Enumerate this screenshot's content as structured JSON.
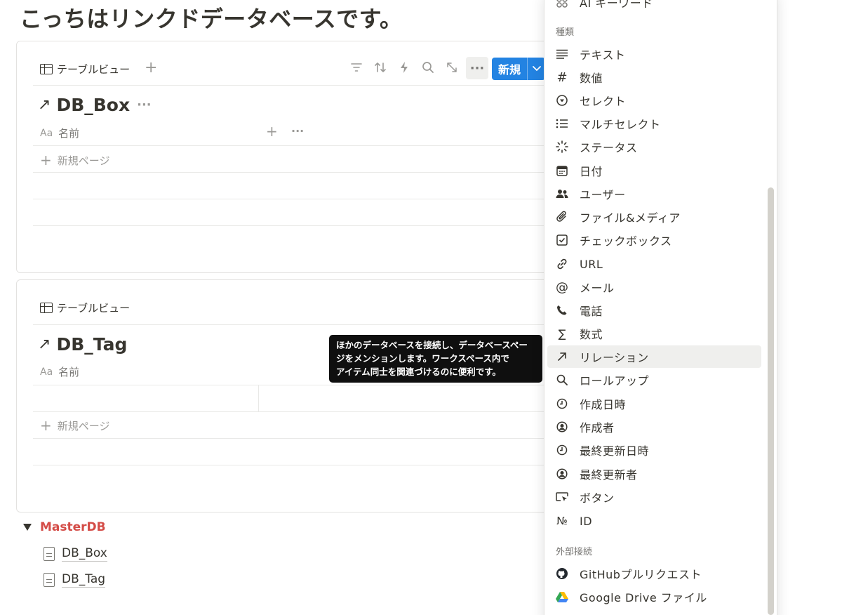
{
  "page": {
    "title": "こっちはリンクドデータベースです。"
  },
  "db1": {
    "view_label": "テーブルビュー",
    "add_view": "+",
    "db_title": "DB_Box",
    "column_icon": "Aa",
    "column_name": "名前",
    "add_column": "+",
    "more": "···",
    "new_page": "新規ページ",
    "new_button": "新規"
  },
  "db2": {
    "view_label": "テーブルビュー",
    "db_title": "DB_Tag",
    "column_icon": "Aa",
    "column_name": "名前",
    "new_page": "新規ページ"
  },
  "tooltip": {
    "lines": [
      "ほかのデータベースを接続し、データベースペー",
      "ジをメンションします。ワークスペース内で",
      "アイテム同士を関連づけるのに便利です。"
    ]
  },
  "menu": {
    "top_item": "AI キーワード",
    "section_types": "種類",
    "types": [
      {
        "label": "テキスト",
        "icon": "text-lines-icon"
      },
      {
        "label": "数値",
        "icon": "hash-icon"
      },
      {
        "label": "セレクト",
        "icon": "select-circle-icon"
      },
      {
        "label": "マルチセレクト",
        "icon": "list-icon"
      },
      {
        "label": "ステータス",
        "icon": "status-spinner-icon"
      },
      {
        "label": "日付",
        "icon": "calendar-icon"
      },
      {
        "label": "ユーザー",
        "icon": "people-icon"
      },
      {
        "label": "ファイル&メディア",
        "icon": "paperclip-icon"
      },
      {
        "label": "チェックボックス",
        "icon": "checkbox-icon"
      },
      {
        "label": "URL",
        "icon": "link-icon"
      },
      {
        "label": "メール",
        "icon": "at-icon"
      },
      {
        "label": "電話",
        "icon": "phone-icon"
      },
      {
        "label": "数式",
        "icon": "sigma-icon"
      },
      {
        "label": "リレーション",
        "icon": "arrow-up-right-icon"
      },
      {
        "label": "ロールアップ",
        "icon": "magnifier-icon"
      },
      {
        "label": "作成日時",
        "icon": "clock-icon"
      },
      {
        "label": "作成者",
        "icon": "person-circle-icon"
      },
      {
        "label": "最終更新日時",
        "icon": "clock-icon"
      },
      {
        "label": "最終更新者",
        "icon": "person-circle-icon"
      },
      {
        "label": "ボタン",
        "icon": "cursor-button-icon"
      },
      {
        "label": "ID",
        "icon": "numero-icon"
      }
    ],
    "section_external": "外部接続",
    "external": [
      {
        "label": "GitHubプルリクエスト",
        "icon": "github-icon"
      },
      {
        "label": "Google Drive ファイル",
        "icon": "google-drive-icon"
      }
    ],
    "highlighted": "リレーション"
  },
  "sidebar_tree": {
    "parent": "MasterDB",
    "children": [
      "DB_Box",
      "DB_Tag"
    ]
  },
  "colors": {
    "accent": "#2383e2",
    "master": "#d44c47",
    "tooltip_bg": "#0f0f0f"
  }
}
